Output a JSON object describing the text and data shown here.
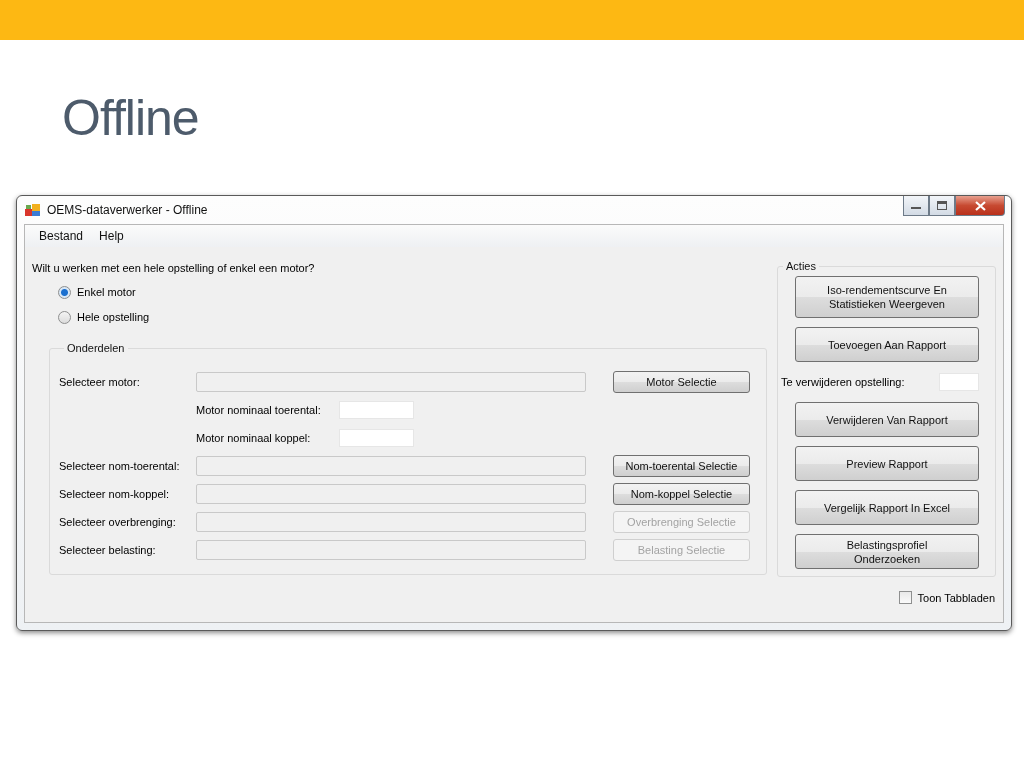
{
  "slide": {
    "title": "Offline"
  },
  "window": {
    "title": "OEMS-dataverwerker - Offline"
  },
  "menu": [
    "Bestand",
    "Help"
  ],
  "question": "Wilt u werken met een hele opstelling of enkel een motor?",
  "modes": [
    {
      "label": "Enkel motor",
      "selected": true
    },
    {
      "label": "Hele opstelling",
      "selected": false
    }
  ],
  "parts": {
    "title": "Onderdelen",
    "rows": [
      {
        "kind": "select",
        "label": "Selecteer motor:",
        "button": "Motor Selectie",
        "disabled": false
      },
      {
        "kind": "number",
        "label": "Motor nominaal toerental:"
      },
      {
        "kind": "number",
        "label": "Motor nominaal koppel:"
      },
      {
        "kind": "select",
        "label": "Selecteer nom-toerental:",
        "button": "Nom-toerental Selectie",
        "disabled": false
      },
      {
        "kind": "select",
        "label": "Selecteer nom-koppel:",
        "button": "Nom-koppel Selectie",
        "disabled": false
      },
      {
        "kind": "select",
        "label": "Selecteer overbrenging:",
        "button": "Overbrenging Selectie",
        "disabled": true
      },
      {
        "kind": "select",
        "label": "Selecteer belasting:",
        "button": "Belasting Selectie",
        "disabled": true
      }
    ]
  },
  "actions": {
    "title": "Acties",
    "items": [
      {
        "kind": "button",
        "label": "Iso-rendementscurve En Statistieken Weergeven"
      },
      {
        "kind": "button",
        "label": "Toevoegen Aan Rapport"
      },
      {
        "kind": "field",
        "label": "Te verwijderen opstelling:"
      },
      {
        "kind": "button",
        "label": "Verwijderen Van Rapport"
      },
      {
        "kind": "button",
        "label": "Preview Rapport"
      },
      {
        "kind": "button",
        "label": "Vergelijk Rapport In Excel"
      },
      {
        "kind": "button",
        "label": "Belastingsprofiel Onderzoeken"
      }
    ]
  },
  "show_tabs": {
    "label": "Toon Tabbladen",
    "checked": false
  }
}
